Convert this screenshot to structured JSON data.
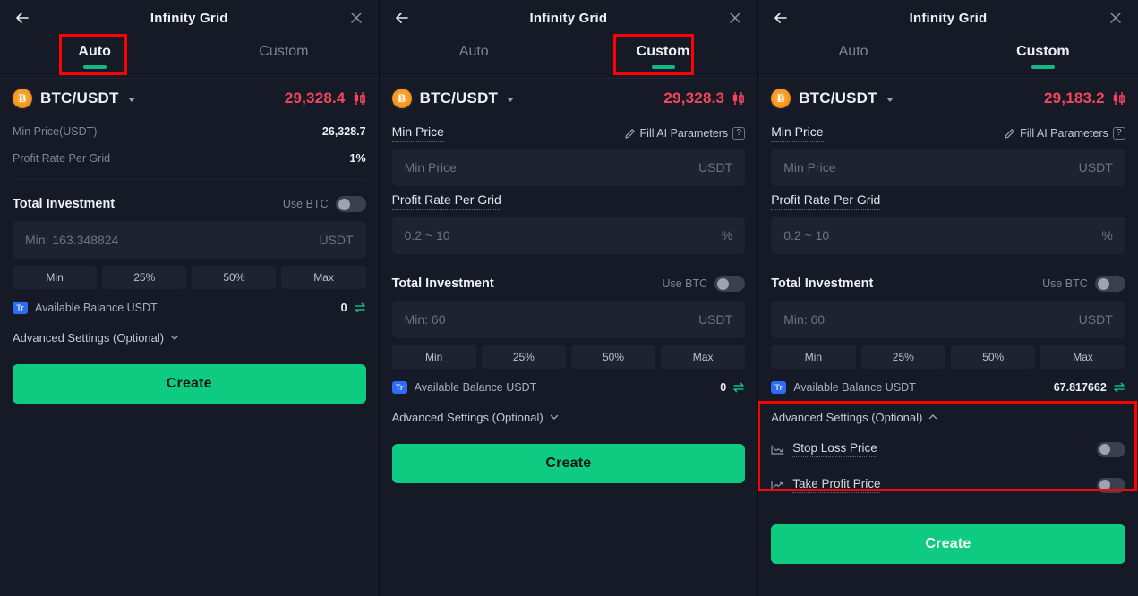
{
  "common": {
    "title": "Infinity Grid",
    "back_icon": "arrow-left-icon",
    "close_icon": "close-icon",
    "tab_auto": "Auto",
    "tab_custom": "Custom",
    "pair": "BTC/USDT",
    "coin_symbol": "Ƀ",
    "create_label": "Create",
    "total_investment_label": "Total Investment",
    "use_btc_label": "Use BTC",
    "quick_buttons": [
      "Min",
      "25%",
      "50%",
      "Max"
    ],
    "balance_label": "Available Balance USDT",
    "balance_badge": "Tr",
    "advanced_label": "Advanced Settings (Optional)",
    "min_price_label": "Min Price",
    "profit_rate_label": "Profit Rate Per Grid",
    "fill_ai_label": "Fill AI Parameters",
    "help_glyph": "?",
    "unit_usdt": "USDT",
    "unit_percent": "%",
    "min_price_placeholder": "Min Price",
    "profit_rate_placeholder": "0.2 ~ 10",
    "accent_green": "#0ecb81",
    "price_red": "#f6465d",
    "annotation_red": "#ff0000",
    "badge_blue": "#2d6cf6",
    "coin_orange": "#f7931a"
  },
  "panels": [
    {
      "id": "auto",
      "active_tab": "Auto",
      "annotated": "tab-auto",
      "price": "29,328.4",
      "rows": [
        {
          "label": "Min Price(USDT)",
          "value": "26,328.7"
        },
        {
          "label": "Profit Rate Per Grid",
          "value": "1%"
        }
      ],
      "investment_placeholder": "Min: 163.348824",
      "balance_value": "0",
      "advanced_expanded": false
    },
    {
      "id": "custom-collapsed",
      "active_tab": "Custom",
      "annotated": "tab-custom",
      "price": "29,328.3",
      "investment_placeholder": "Min: 60",
      "balance_value": "0",
      "advanced_expanded": false
    },
    {
      "id": "custom-expanded",
      "active_tab": "Custom",
      "annotated": "advanced-settings",
      "price": "29,183.2",
      "investment_placeholder": "Min: 60",
      "balance_value": "67.817662",
      "advanced_expanded": true,
      "advanced_items": [
        {
          "label": "Stop Loss Price",
          "icon": "trend-down-icon",
          "toggle": "off"
        },
        {
          "label": "Take Profit Price",
          "icon": "trend-up-icon",
          "toggle": "off"
        }
      ]
    }
  ]
}
